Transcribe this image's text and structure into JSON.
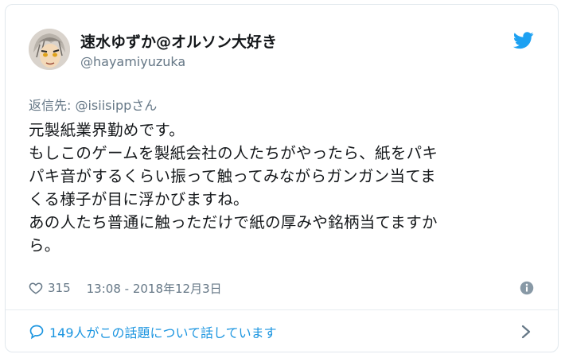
{
  "tweet": {
    "display_name": "速水ゆずか@オルソン大好き",
    "handle": "@hayamiyuzuka",
    "reply_prefix": "返信先: ",
    "reply_to": "@isiisipp",
    "reply_suffix": "さん",
    "lines": [
      "元製紙業界勤めです。",
      "もしこのゲームを製紙会社の人たちがやったら、紙をパキ",
      "パキ音がするくらい振って触ってみながらガンガン当てま",
      "くる様子が目に浮かびますね。",
      "あの人たち普通に触っただけで紙の厚みや銘柄当てますか",
      "ら。"
    ],
    "likes": "315",
    "timestamp": "13:08 - 2018年12月3日",
    "conversation": "149人がこの話題について話しています"
  },
  "icons": {
    "logo": "twitter-bird-icon",
    "like": "heart-icon",
    "info": "info-icon",
    "conversation": "speech-bubble-icon",
    "next": "chevron-right-icon"
  },
  "colors": {
    "accent": "#1da1f2",
    "link": "#1b95e0",
    "muted": "#657786",
    "text": "#14171a"
  }
}
